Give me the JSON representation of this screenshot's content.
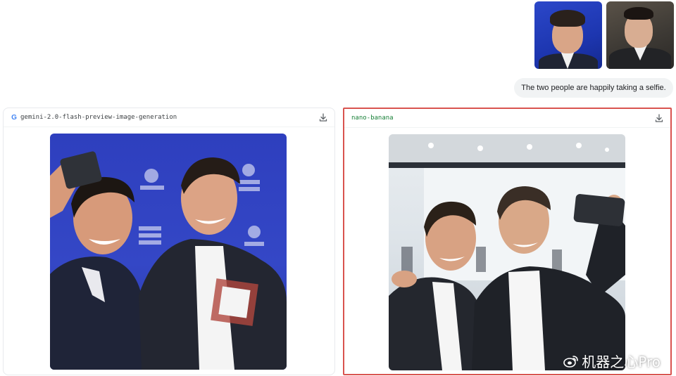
{
  "user_message": {
    "reference_images": [
      "person-portrait-blue-background",
      "person-portrait-dark-background"
    ],
    "prompt": "The two people are happily taking a selfie."
  },
  "outputs": [
    {
      "model": "gemini-2.0-flash-preview-image-generation",
      "provider_icon": "google-g-icon",
      "action_icon": "download-icon",
      "image": "two-men-selfie-blue-background"
    },
    {
      "model": "nano-banana",
      "action_icon": "download-icon",
      "image": "two-men-selfie-event-hall",
      "highlight_color": "#d9534f"
    }
  ],
  "watermark": {
    "text": "机器之心Pro",
    "icon": "weibo-icon"
  }
}
